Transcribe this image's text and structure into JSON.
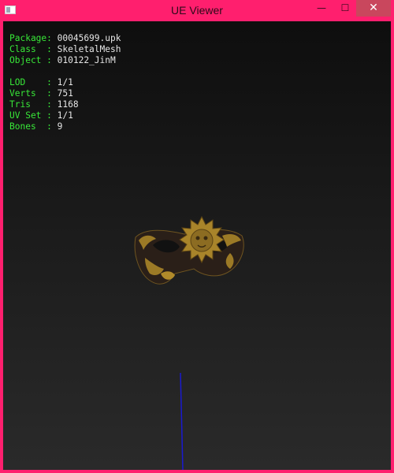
{
  "window": {
    "title": "UE Viewer",
    "controls": {
      "minimize": "—",
      "maximize": "☐",
      "close": "✕"
    }
  },
  "info": {
    "package": {
      "label": "Package:",
      "value": "00045699.upk"
    },
    "class": {
      "label": "Class  :",
      "value": "SkeletalMesh"
    },
    "object": {
      "label": "Object :",
      "value": "010122_JinM"
    },
    "lod": {
      "label": "LOD    :",
      "value": "1/1"
    },
    "verts": {
      "label": "Verts  :",
      "value": "751"
    },
    "tris": {
      "label": "Tris   :",
      "value": "1168"
    },
    "uvset": {
      "label": "UV Set :",
      "value": "1/1"
    },
    "bones": {
      "label": "Bones  :",
      "value": "9"
    }
  },
  "colors": {
    "window_frame": "#ff1f6e",
    "label_text": "#38e838",
    "value_text": "#e6e6e6",
    "axis_line": "#1a1ad0",
    "mask_gold": "#9c7a26",
    "mask_dark": "#2a1f18"
  }
}
